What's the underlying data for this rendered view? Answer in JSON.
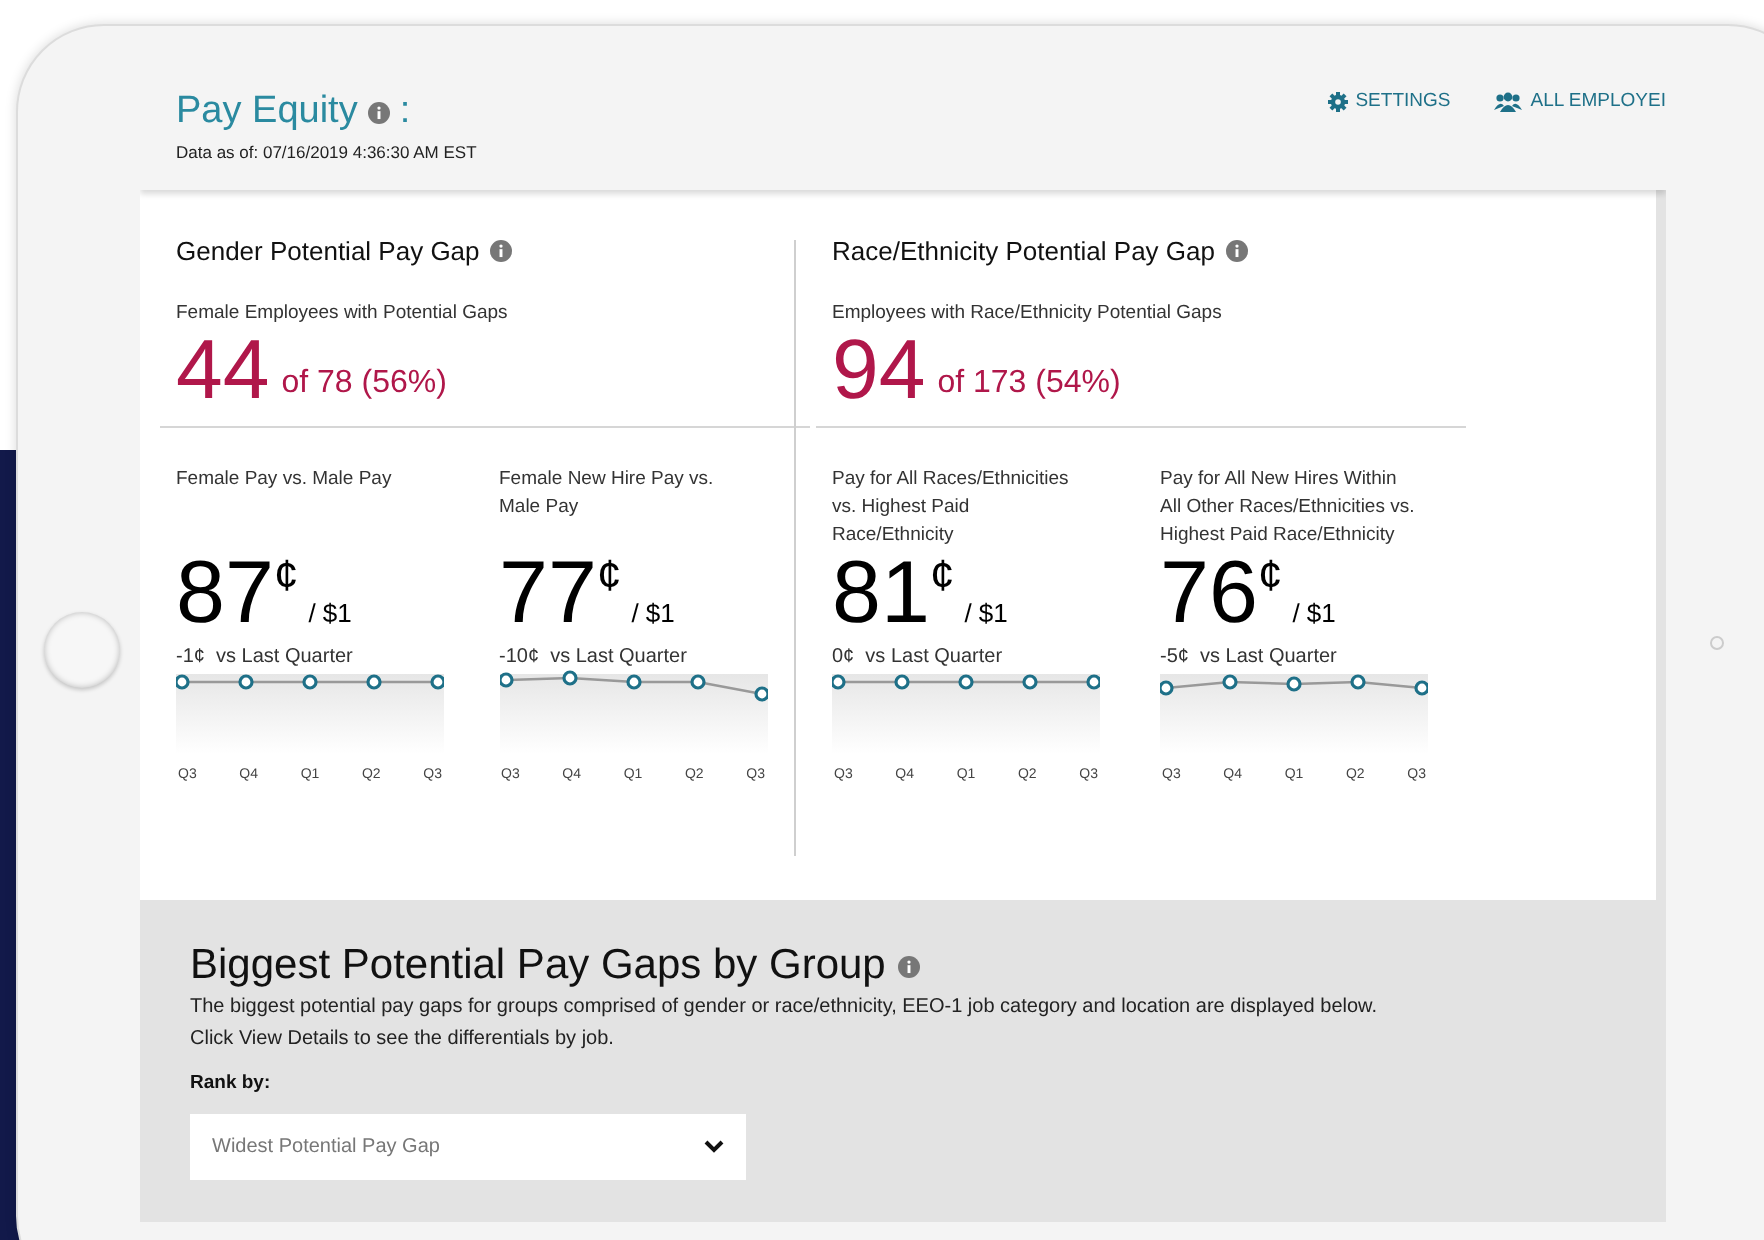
{
  "header": {
    "title": "Pay Equity",
    "menu_glyph": ":",
    "data_as_of": "Data as of: 07/16/2019 4:36:30 AM EST",
    "links": [
      {
        "kind": "settings",
        "label": "SETTINGS"
      },
      {
        "kind": "employees",
        "label": "ALL EMPLOYEI"
      }
    ]
  },
  "sections": [
    {
      "title": "Gender Potential Pay Gap",
      "subtitle": "Female Employees with Potential Gaps",
      "count": "44",
      "total": "of 78 (56%)",
      "metrics": [
        {
          "label": "Female Pay vs. Male Pay",
          "value": "87",
          "unit": "¢",
          "per": "/ $1",
          "change": "-1¢  vs Last Quarter",
          "kind": "flat",
          "quarters": [
            "Q3",
            "Q4",
            "Q1",
            "Q2",
            "Q3"
          ]
        },
        {
          "label": "Female New Hire Pay vs. Male Pay",
          "value": "77",
          "unit": "¢",
          "per": "/ $1",
          "change": "-10¢  vs Last Quarter",
          "kind": "declining",
          "quarters": [
            "Q3",
            "Q4",
            "Q1",
            "Q2",
            "Q3"
          ]
        }
      ]
    },
    {
      "title": "Race/Ethnicity Potential Pay Gap",
      "subtitle": "Employees with Race/Ethnicity Potential Gaps",
      "count": "94",
      "total": "of 173 (54%)",
      "metrics": [
        {
          "label": "Pay for All Races/Ethnicities vs. Highest Paid Race/Ethnicity",
          "value": "81",
          "unit": "¢",
          "per": "/ $1",
          "change": "0¢  vs Last Quarter",
          "kind": "flat",
          "quarters": [
            "Q3",
            "Q4",
            "Q1",
            "Q2",
            "Q3"
          ]
        },
        {
          "label": "Pay for All New Hires Within All Other Races/Ethnicities vs. Highest Paid Race/Ethnicity",
          "value": "76",
          "unit": "¢",
          "per": "/ $1",
          "change": "-5¢  vs Last Quarter",
          "kind": "dip",
          "quarters": [
            "Q3",
            "Q4",
            "Q1",
            "Q2",
            "Q3"
          ]
        }
      ]
    }
  ],
  "groups": {
    "title": "Biggest Potential Pay Gaps by Group",
    "description": "The biggest potential pay gaps for groups comprised of gender or race/ethnicity, EEO-1 job category and location are displayed below. Click View Details to see the differentials by job.",
    "rank_label": "Rank by:",
    "rank_value": "Widest Potential Pay Gap"
  }
}
